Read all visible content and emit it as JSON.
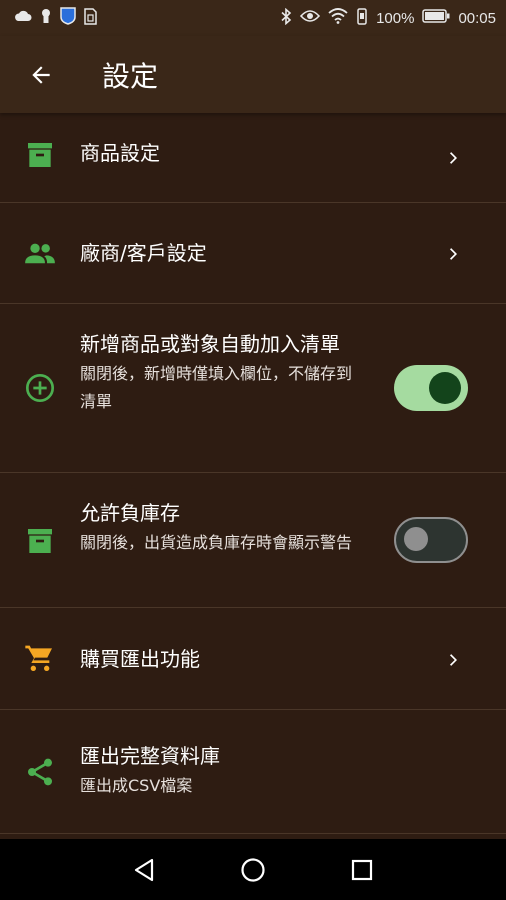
{
  "status_bar": {
    "left_icons": [
      "cloud-icon",
      "keyhole-icon",
      "shield-icon",
      "sim-icon"
    ],
    "right_icons": [
      "bluetooth-icon",
      "eye-icon",
      "wifi-icon",
      "vibrate-icon"
    ],
    "battery_percent": "100%",
    "time": "00:05"
  },
  "app_bar": {
    "title": "設定",
    "back_icon": "arrow-left-icon"
  },
  "settings": [
    {
      "id": "product-settings",
      "icon": "archive-icon",
      "icon_color": "#4caf50",
      "title": "商品設定",
      "subtitle": "",
      "control": "chevron"
    },
    {
      "id": "vendor-customer-settings",
      "icon": "people-icon",
      "icon_color": "#4caf50",
      "title": "廠商/客戶設定",
      "subtitle": "",
      "control": "chevron"
    },
    {
      "id": "auto-add-list",
      "icon": "add-circle-icon",
      "icon_color": "#4caf50",
      "title": "新增商品或對象自動加入清單",
      "subtitle": "關閉後，新增時僅填入欄位，不儲存到清單",
      "control": "toggle",
      "toggle_on": true
    },
    {
      "id": "allow-negative-stock",
      "icon": "archive-icon",
      "icon_color": "#4caf50",
      "title": "允許負庫存",
      "subtitle": "關閉後，出貨造成負庫存時會顯示警告",
      "control": "toggle",
      "toggle_on": false
    },
    {
      "id": "buy-export",
      "icon": "cart-icon",
      "icon_color": "#f5a623",
      "title": "購買匯出功能",
      "subtitle": "",
      "control": "chevron"
    },
    {
      "id": "export-database",
      "icon": "share-icon",
      "icon_color": "#4caf50",
      "title": "匯出完整資料庫",
      "subtitle": "匯出成CSV檔案",
      "control": "none"
    }
  ],
  "nav_bar": {
    "icons": [
      "nav-back-icon",
      "nav-home-icon",
      "nav-recents-icon"
    ]
  },
  "colors": {
    "background": "#2e1c12",
    "appbar": "#3a2718",
    "accent_green": "#4caf50",
    "accent_orange": "#f5a623",
    "toggle_on_track": "#a5dba0",
    "toggle_on_knob": "#13441b"
  }
}
